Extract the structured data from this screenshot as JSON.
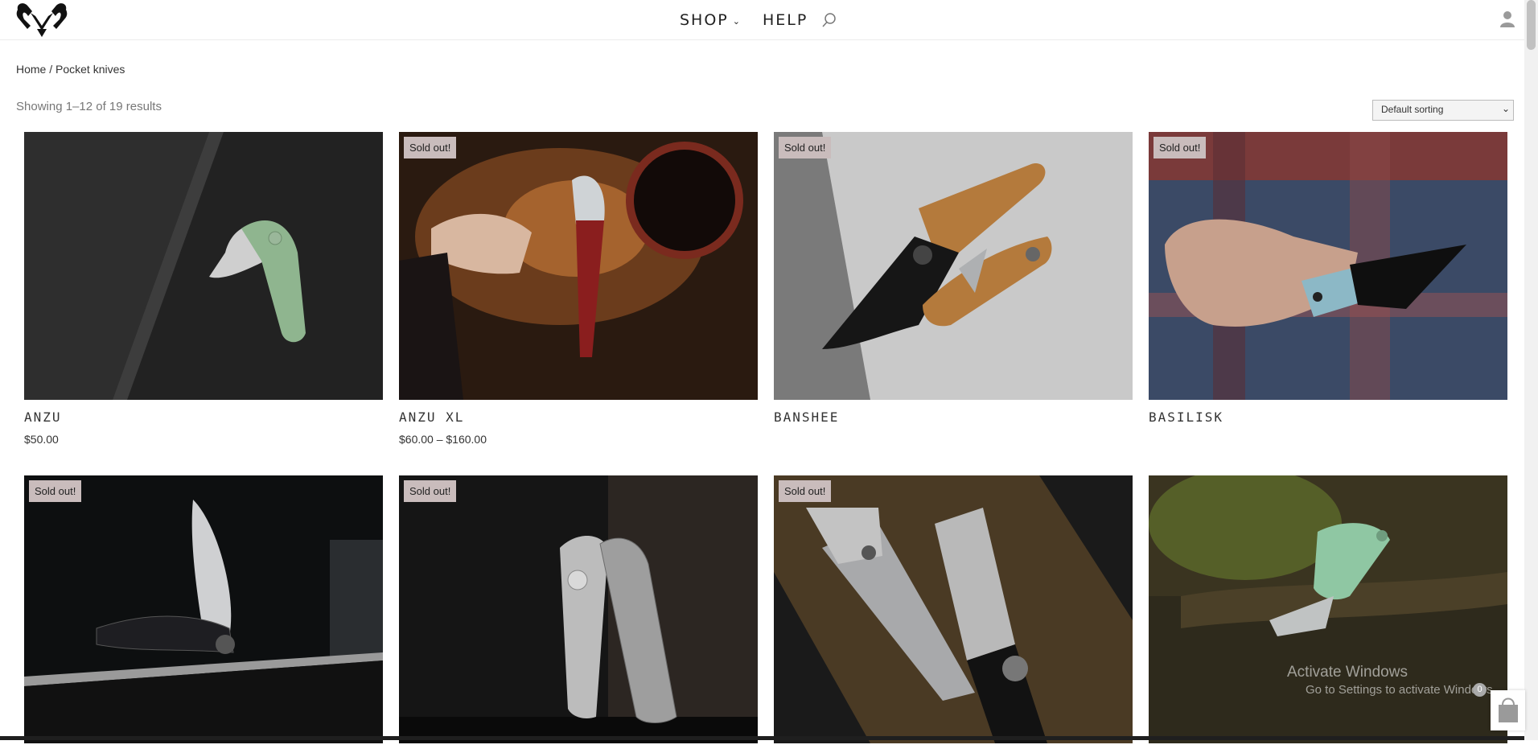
{
  "header": {
    "nav": [
      {
        "label": "SHOP",
        "has_dropdown": true
      },
      {
        "label": "HELP",
        "has_dropdown": false
      }
    ]
  },
  "breadcrumb": "Home / Pocket knives",
  "result_count": "Showing 1–12 of 19 results",
  "sort": {
    "selected": "Default sorting"
  },
  "products": [
    {
      "name": "ANZU",
      "price": "$50.00",
      "badge": ""
    },
    {
      "name": "ANZU XL",
      "price": "$60.00 – $160.00",
      "badge": "Sold out!"
    },
    {
      "name": "BANSHEE",
      "price": "",
      "badge": "Sold out!"
    },
    {
      "name": "BASILISK",
      "price": "",
      "badge": "Sold out!"
    },
    {
      "name": "",
      "price": "",
      "badge": "Sold out!"
    },
    {
      "name": "",
      "price": "",
      "badge": "Sold out!"
    },
    {
      "name": "",
      "price": "",
      "badge": "Sold out!"
    },
    {
      "name": "",
      "price": "",
      "badge": ""
    }
  ],
  "watermark": {
    "line1": "Activate Windows",
    "line2": "Go to Settings to activate Windows."
  },
  "cart": {
    "count": "0"
  },
  "icons": [
    "logo",
    "chevron-down-icon",
    "search-icon",
    "user-icon",
    "cart-icon"
  ]
}
